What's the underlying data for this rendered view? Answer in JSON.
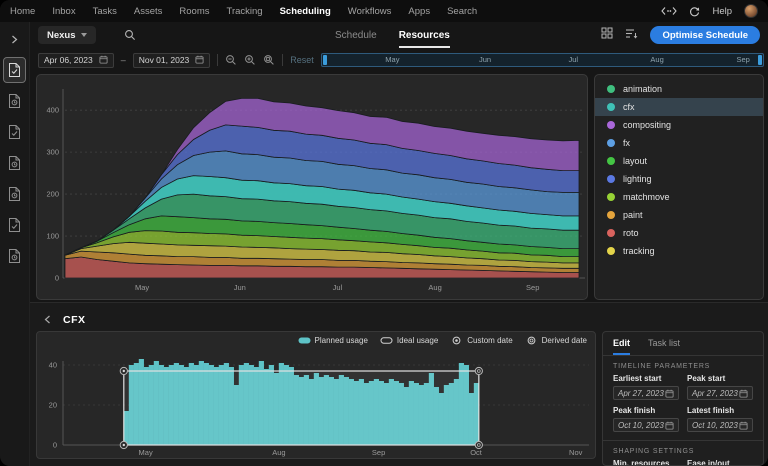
{
  "top_nav": {
    "items": [
      {
        "label": "Home",
        "active": false
      },
      {
        "label": "Inbox",
        "active": false
      },
      {
        "label": "Tasks",
        "active": false
      },
      {
        "label": "Assets",
        "active": false
      },
      {
        "label": "Rooms",
        "active": false
      },
      {
        "label": "Tracking",
        "active": false
      },
      {
        "label": "Scheduling",
        "active": true
      },
      {
        "label": "Workflows",
        "active": false
      },
      {
        "label": "Apps",
        "active": false
      },
      {
        "label": "Search",
        "active": false
      }
    ],
    "help_label": "Help"
  },
  "toolbar": {
    "project_label": "Nexus",
    "tabs": [
      {
        "label": "Schedule",
        "active": false
      },
      {
        "label": "Resources",
        "active": true
      }
    ],
    "optimise_label": "Optimise Schedule"
  },
  "controls": {
    "start_date": "Apr 06, 2023",
    "end_date": "Nov 01, 2023",
    "range_separator": "–",
    "reset_label": "Reset",
    "minimap_months": [
      {
        "label": "May",
        "frac": 0.16
      },
      {
        "label": "Jun",
        "frac": 0.37
      },
      {
        "label": "Jul",
        "frac": 0.57
      },
      {
        "label": "Aug",
        "frac": 0.76
      },
      {
        "label": "Sep",
        "frac": 0.955
      }
    ]
  },
  "sidebar": {
    "items": [
      {
        "type": "check",
        "active": true
      },
      {
        "type": "clock",
        "active": false
      },
      {
        "type": "check",
        "active": false
      },
      {
        "type": "clock",
        "active": false
      },
      {
        "type": "clock",
        "active": false
      },
      {
        "type": "check",
        "active": false
      },
      {
        "type": "clock",
        "active": false
      }
    ]
  },
  "legend": {
    "selected": "cfx",
    "items": [
      {
        "label": "animation",
        "color": "#3fbf7f"
      },
      {
        "label": "cfx",
        "color": "#3fc1b7"
      },
      {
        "label": "compositing",
        "color": "#a967d9"
      },
      {
        "label": "fx",
        "color": "#5d9fe3"
      },
      {
        "label": "layout",
        "color": "#44c544"
      },
      {
        "label": "lighting",
        "color": "#5b79e3"
      },
      {
        "label": "matchmove",
        "color": "#97d235"
      },
      {
        "label": "paint",
        "color": "#e5a43c"
      },
      {
        "label": "roto",
        "color": "#d9635e"
      },
      {
        "label": "tracking",
        "color": "#e4d44a"
      }
    ]
  },
  "chart_data": [
    {
      "type": "area",
      "stacked": true,
      "ylim": [
        0,
        460
      ],
      "yticks": [
        0,
        100,
        200,
        300,
        400
      ],
      "xticklabels": [
        {
          "label": "May",
          "frac": 0.15
        },
        {
          "label": "Jun",
          "frac": 0.34
        },
        {
          "label": "Jul",
          "frac": 0.53
        },
        {
          "label": "Aug",
          "frac": 0.72
        },
        {
          "label": "Sep",
          "frac": 0.91
        }
      ],
      "series": [
        {
          "name": "roto",
          "color": "#d9635e",
          "values": [
            46,
            50,
            44,
            40,
            36,
            34,
            33,
            32,
            31,
            30,
            30,
            29,
            29,
            28,
            28,
            27,
            27,
            26,
            26,
            25,
            24,
            23,
            22,
            21,
            20,
            19,
            18,
            17,
            16,
            15,
            14,
            13,
            13
          ]
        },
        {
          "name": "paint",
          "color": "#e5a43c",
          "values": [
            8,
            14,
            18,
            20,
            21,
            20,
            20,
            19,
            20,
            19,
            19,
            18,
            18,
            18,
            17,
            17,
            17,
            16,
            16,
            15,
            15,
            14,
            14,
            13,
            13,
            12,
            12,
            11,
            11,
            10,
            10,
            10,
            10
          ]
        },
        {
          "name": "tracking",
          "color": "#e4d44a",
          "values": [
            0,
            6,
            14,
            22,
            28,
            29,
            28,
            28,
            27,
            28,
            27,
            27,
            26,
            26,
            25,
            25,
            24,
            24,
            23,
            22,
            22,
            21,
            20,
            19,
            18,
            17,
            16,
            15,
            15,
            14,
            14,
            13,
            13
          ]
        },
        {
          "name": "matchmove",
          "color": "#97d235",
          "values": [
            0,
            2,
            8,
            16,
            24,
            30,
            31,
            30,
            30,
            29,
            29,
            28,
            28,
            27,
            27,
            26,
            26,
            25,
            24,
            24,
            23,
            22,
            21,
            20,
            20,
            19,
            18,
            17,
            17,
            16,
            16,
            15,
            15
          ]
        },
        {
          "name": "layout",
          "color": "#44c544",
          "values": [
            0,
            0,
            4,
            10,
            18,
            28,
            36,
            37,
            36,
            35,
            35,
            34,
            34,
            33,
            33,
            32,
            31,
            30,
            29,
            28,
            27,
            26,
            25,
            24,
            23,
            22,
            21,
            21,
            20,
            20,
            19,
            19,
            19
          ]
        },
        {
          "name": "animation",
          "color": "#3fbf7f",
          "values": [
            0,
            0,
            0,
            6,
            14,
            26,
            40,
            52,
            56,
            55,
            54,
            53,
            53,
            52,
            52,
            51,
            51,
            50,
            50,
            49,
            49,
            48,
            48,
            47,
            47,
            46,
            46,
            45,
            45,
            44,
            44,
            44,
            44
          ]
        },
        {
          "name": "cfx",
          "color": "#3fc1b7",
          "values": [
            0,
            0,
            0,
            0,
            6,
            16,
            28,
            38,
            44,
            46,
            45,
            44,
            44,
            43,
            43,
            42,
            42,
            41,
            41,
            40,
            40,
            39,
            38,
            38,
            37,
            37,
            36,
            36,
            35,
            35,
            34,
            34,
            34
          ]
        },
        {
          "name": "fx",
          "color": "#5d9fe3",
          "values": [
            0,
            0,
            0,
            0,
            0,
            8,
            20,
            34,
            48,
            58,
            64,
            63,
            62,
            61,
            61,
            60,
            60,
            59,
            59,
            58,
            58,
            57,
            58,
            57,
            57,
            56,
            57,
            56,
            56,
            56,
            55,
            56,
            56
          ]
        },
        {
          "name": "lighting",
          "color": "#5b79e3",
          "values": [
            0,
            0,
            0,
            0,
            0,
            0,
            10,
            24,
            38,
            52,
            62,
            66,
            65,
            64,
            64,
            63,
            62,
            62,
            61,
            60,
            60,
            59,
            58,
            58,
            57,
            56,
            55,
            55,
            54,
            53,
            53,
            52,
            52
          ]
        },
        {
          "name": "compositing",
          "color": "#a967d9",
          "values": [
            0,
            0,
            0,
            0,
            0,
            0,
            0,
            12,
            28,
            42,
            56,
            66,
            69,
            68,
            67,
            67,
            66,
            66,
            65,
            64,
            65,
            64,
            65,
            64,
            65,
            66,
            66,
            67,
            68,
            69,
            70,
            71,
            72
          ]
        }
      ]
    },
    {
      "type": "bar",
      "ylim": [
        0,
        45
      ],
      "yticks": [
        0,
        20,
        40
      ],
      "xticklabels": [
        {
          "label": "May",
          "frac": 0.194
        },
        {
          "label": "Aug",
          "frac": 0.432
        },
        {
          "label": "Sep",
          "frac": 0.61
        },
        {
          "label": "Oct",
          "frac": 0.784
        },
        {
          "label": "Nov",
          "frac": 0.962
        }
      ],
      "bar_color": "#5ec3c7",
      "values": [
        17,
        40,
        41,
        43,
        39,
        40,
        42,
        40,
        39,
        40,
        41,
        40,
        39,
        41,
        40,
        42,
        41,
        40,
        39,
        40,
        41,
        39,
        30,
        40,
        41,
        40,
        39,
        42,
        38,
        40,
        36,
        41,
        40,
        39,
        35,
        34,
        35,
        33,
        36,
        34,
        35,
        34,
        33,
        35,
        34,
        33,
        32,
        33,
        31,
        32,
        33,
        32,
        31,
        33,
        32,
        31,
        29,
        32,
        31,
        30,
        31,
        36,
        29,
        26,
        30,
        31,
        33,
        41,
        40,
        26,
        31
      ],
      "ideal_usage": 37,
      "task_range_frac": [
        0.155,
        0.789
      ]
    }
  ],
  "detail": {
    "title": "CFX",
    "legend": [
      {
        "label": "Planned usage",
        "type": "filled-pill"
      },
      {
        "label": "Ideal usage",
        "type": "outline-pill"
      },
      {
        "label": "Custom date",
        "type": "dot-circle"
      },
      {
        "label": "Derived date",
        "type": "ring-circle"
      }
    ],
    "panel": {
      "tabs": [
        {
          "label": "Edit",
          "active": true
        },
        {
          "label": "Task list",
          "active": false
        }
      ],
      "timeline_section_title": "TIMELINE PARAMETERS",
      "fields": [
        {
          "label": "Earliest start",
          "value": "Apr 27, 2023"
        },
        {
          "label": "Peak start",
          "value": "Apr 27, 2023"
        },
        {
          "label": "Peak finish",
          "value": "Oct 10, 2023"
        },
        {
          "label": "Latest finish",
          "value": "Oct 10, 2023"
        }
      ],
      "shaping_section_title": "SHAPING SETTINGS",
      "shaping_fields": [
        {
          "label": "Min. resources"
        },
        {
          "label": "Ease in/out"
        }
      ]
    }
  }
}
